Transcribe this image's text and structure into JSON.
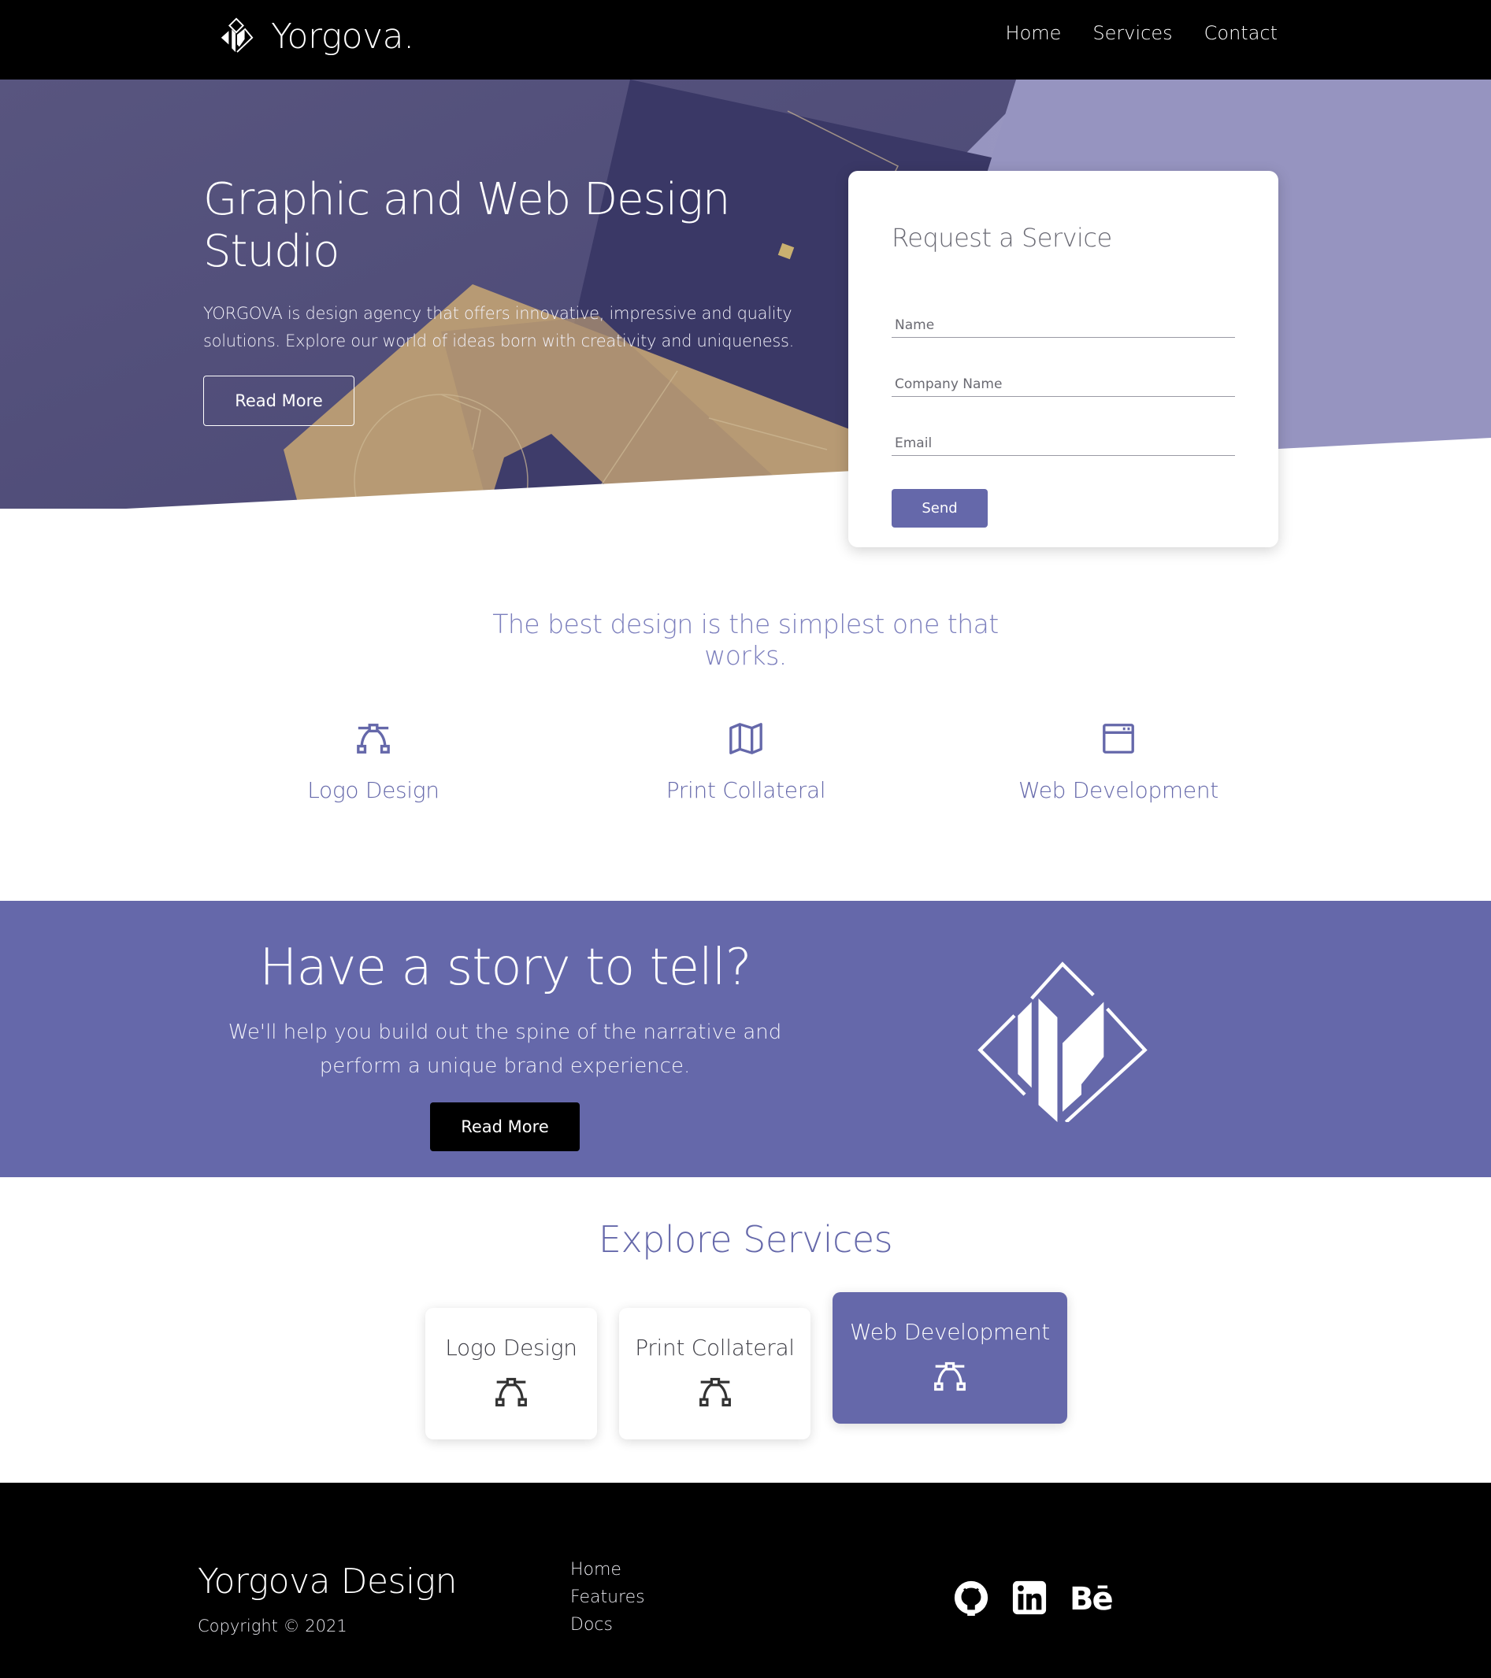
{
  "header": {
    "brand_name": "Yorgova.",
    "nav": [
      "Home",
      "Services",
      "Contact"
    ]
  },
  "hero": {
    "title": "Graphic and Web Design Studio",
    "text": "YORGOVA is design agency that offers innovative, impressive and quality solutions. Explore our world of ideas born with creativity and uniqueness.",
    "button": "Read More"
  },
  "form": {
    "title": "Request a Service",
    "name_placeholder": "Name",
    "company_placeholder": "Company Name",
    "email_placeholder": "Email",
    "send_label": "Send"
  },
  "tagline": "The best design is the simplest one that works.",
  "services": [
    {
      "label": "Logo Design",
      "icon": "bezier-icon"
    },
    {
      "label": "Print Collateral",
      "icon": "map-icon"
    },
    {
      "label": "Web Development",
      "icon": "browser-icon"
    }
  ],
  "story": {
    "title": "Have a story to tell?",
    "text": "We'll help you build out the spine of the narrative and perform a unique brand experience.",
    "button": "Read More"
  },
  "explore": {
    "title": "Explore Services",
    "cards": [
      {
        "label": "Logo Design",
        "icon": "bezier-icon"
      },
      {
        "label": "Print Collateral",
        "icon": "bezier-icon"
      },
      {
        "label": "Web Development",
        "icon": "bezier-icon",
        "active": true
      }
    ]
  },
  "footer": {
    "brand": "Yorgova Design",
    "copyright": "Copyright © 2021",
    "links": [
      "Home",
      "Features",
      "Docs"
    ],
    "social": [
      "github-icon",
      "linkedin-icon",
      "behance-icon"
    ],
    "behance_text": "Bē"
  },
  "colors": {
    "accent": "#6568aa",
    "hero_overlay": "#5b5a8a",
    "header_bg": "#000000",
    "footer_bg": "#000000"
  }
}
